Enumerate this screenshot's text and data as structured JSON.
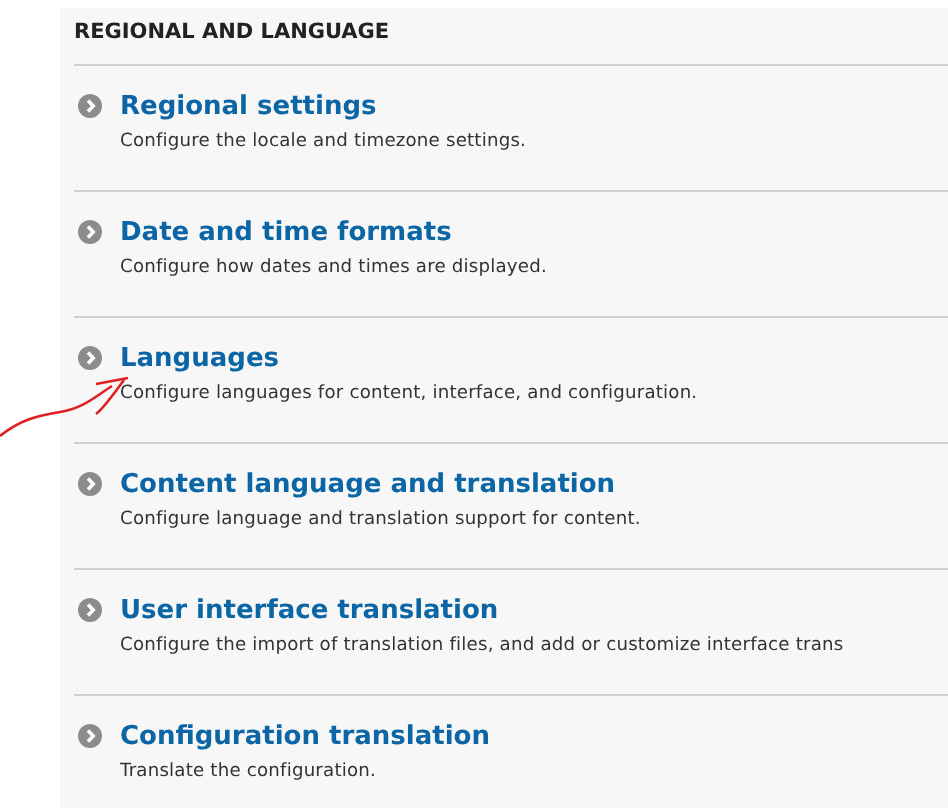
{
  "section": {
    "title": "REGIONAL AND LANGUAGE"
  },
  "items": [
    {
      "title": "Regional settings",
      "description": "Configure the locale and timezone settings."
    },
    {
      "title": "Date and time formats",
      "description": "Configure how dates and times are displayed."
    },
    {
      "title": "Languages",
      "description": "Configure languages for content, interface, and configuration."
    },
    {
      "title": "Content language and translation",
      "description": "Configure language and translation support for content."
    },
    {
      "title": "User interface translation",
      "description": "Configure the import of translation files, and add or customize interface trans"
    },
    {
      "title": "Configuration translation",
      "description": "Translate the configuration."
    }
  ]
}
